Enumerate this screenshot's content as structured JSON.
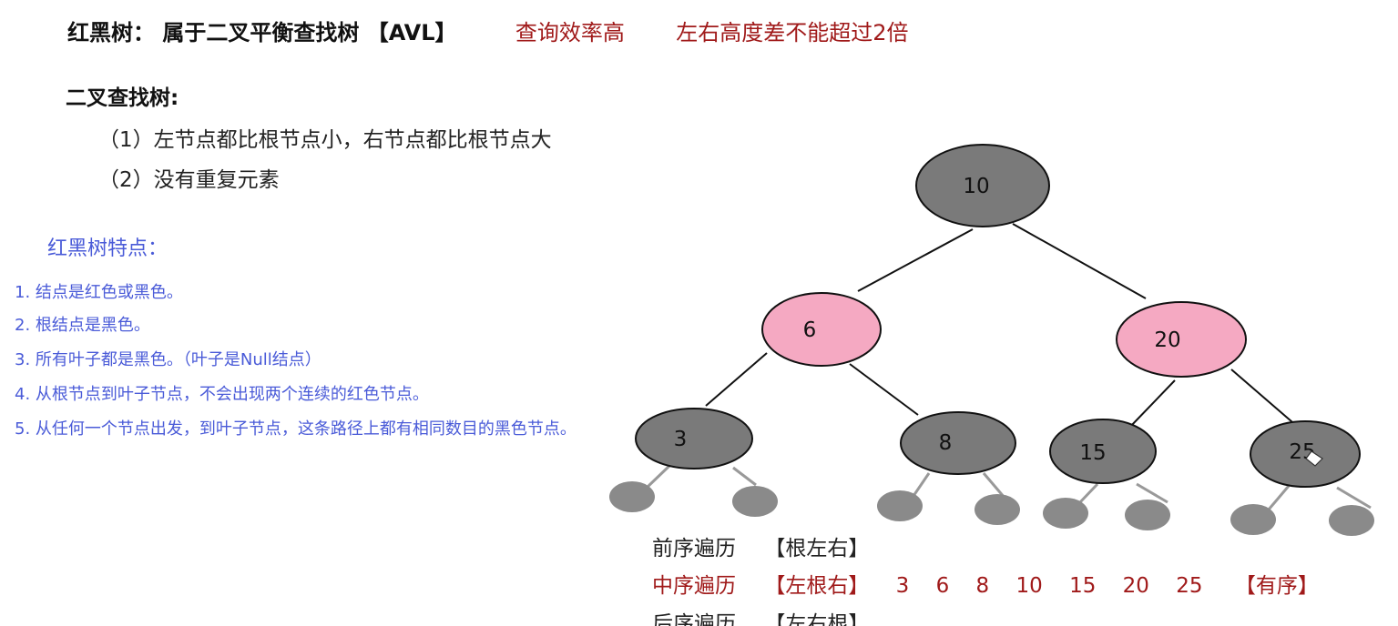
{
  "header": {
    "title": "红黑树：  属于二叉平衡查找树 【AVL】",
    "note1": "查询效率高",
    "note2": "左右高度差不能超过2倍"
  },
  "bst": {
    "heading": "二叉查找树:",
    "rules": [
      "（1）左节点都比根节点小，右节点都比根节点大",
      "（2）没有重复元素"
    ]
  },
  "rbtree": {
    "heading": "红黑树特点：",
    "items": [
      "1. 结点是红色或黑色。",
      "2. 根结点是黑色。",
      "3. 所有叶子都是黑色。（叶子是Null结点）",
      "4. 从根节点到叶子节点，不会出现两个连续的红色节点。",
      "5. 从任何一个节点出发，到叶子节点，这条路径上都有相同数目的黑色节点。"
    ]
  },
  "tree": {
    "colors": {
      "black": "#7a7a7a",
      "red": "#f5a9c2",
      "stroke": "#111111",
      "leaf": "#8a8a8a"
    },
    "nodes": [
      {
        "id": "n10",
        "label": "10",
        "color": "black"
      },
      {
        "id": "n6",
        "label": "6",
        "color": "red"
      },
      {
        "id": "n20",
        "label": "20",
        "color": "red"
      },
      {
        "id": "n3",
        "label": "3",
        "color": "black"
      },
      {
        "id": "n8",
        "label": "8",
        "color": "black"
      },
      {
        "id": "n15",
        "label": "15",
        "color": "black"
      },
      {
        "id": "n25",
        "label": "25",
        "color": "black"
      }
    ]
  },
  "traversal": {
    "preorder": {
      "name": "前序遍历",
      "tag": "【根左右】"
    },
    "inorder": {
      "name": "中序遍历",
      "tag": "【左根右】",
      "values": [
        "3",
        "6",
        "8",
        "10",
        "15",
        "20",
        "25"
      ],
      "note": "【有序】"
    },
    "postorder": {
      "name": "后序遍历",
      "tag": "【左右根】"
    }
  }
}
